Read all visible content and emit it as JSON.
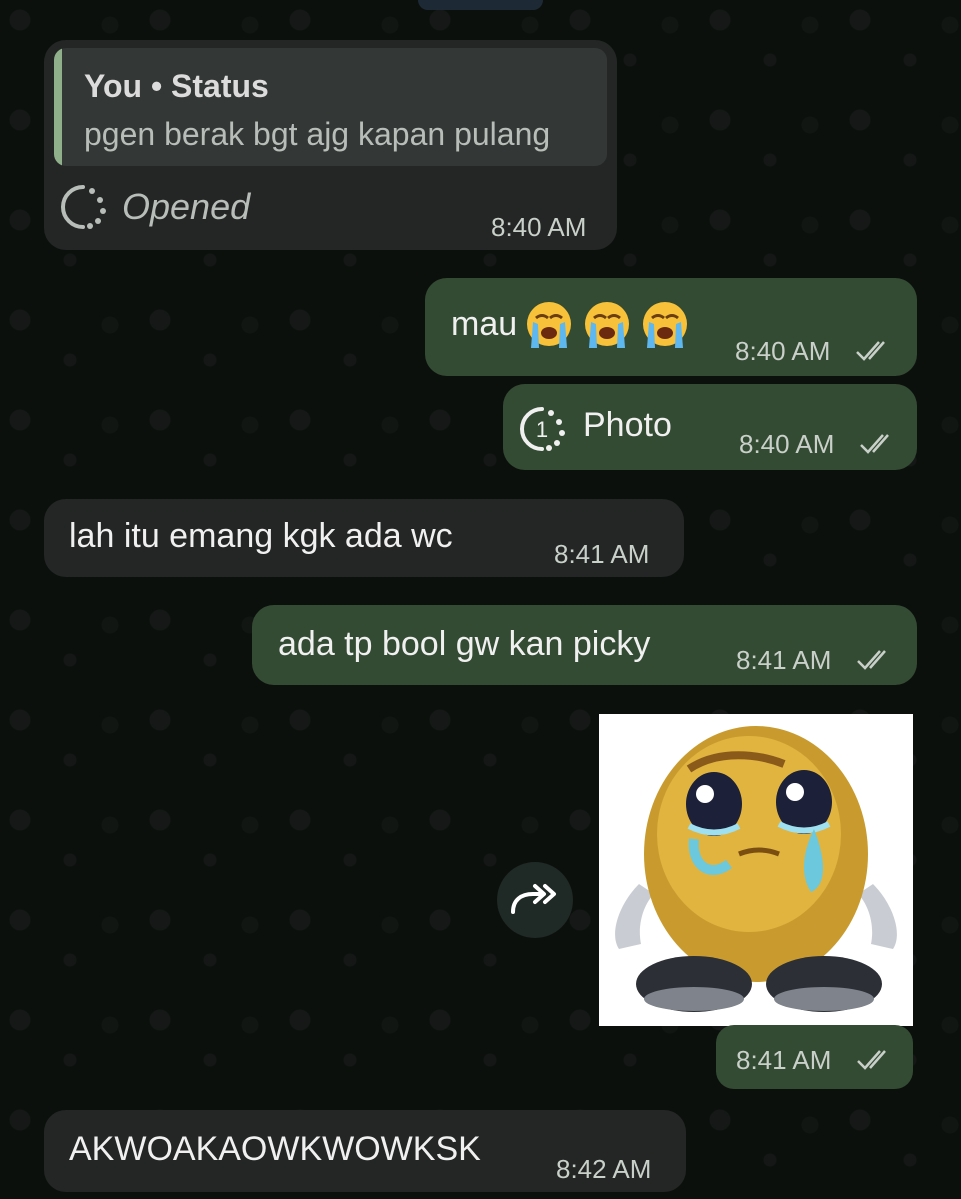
{
  "messages": [
    {
      "direction": "incoming",
      "quote": {
        "sender": "You",
        "separator": "•",
        "source": "Status",
        "text": "pgen berak bgt ajg kapan pulang"
      },
      "status_label": "Opened",
      "status_icon": "view-once-opened-icon",
      "time": "8:40 AM"
    },
    {
      "direction": "outgoing",
      "text": "mau",
      "emojis": [
        "loudly-crying-face",
        "loudly-crying-face",
        "loudly-crying-face"
      ],
      "time": "8:40 AM",
      "receipt": "double-check-icon"
    },
    {
      "direction": "outgoing",
      "icon": "view-once-icon",
      "icon_text": "1",
      "text": "Photo",
      "time": "8:40 AM",
      "receipt": "double-check-icon"
    },
    {
      "direction": "incoming",
      "text": "lah itu emang kgk ada wc",
      "time": "8:41 AM"
    },
    {
      "direction": "outgoing",
      "text": "ada tp bool gw kan picky",
      "time": "8:41 AM",
      "receipt": "double-check-icon"
    },
    {
      "direction": "outgoing",
      "sticker": "crying-emoji-sticker",
      "time": "8:41 AM",
      "receipt": "double-check-icon"
    },
    {
      "direction": "incoming",
      "text": "AKWOAKAOWKWOWKSK",
      "time": "8:42 AM"
    }
  ],
  "colors": {
    "incoming_bubble": "#232625",
    "outgoing_bubble": "#344b33",
    "quote_bar": "#8fb08b"
  }
}
